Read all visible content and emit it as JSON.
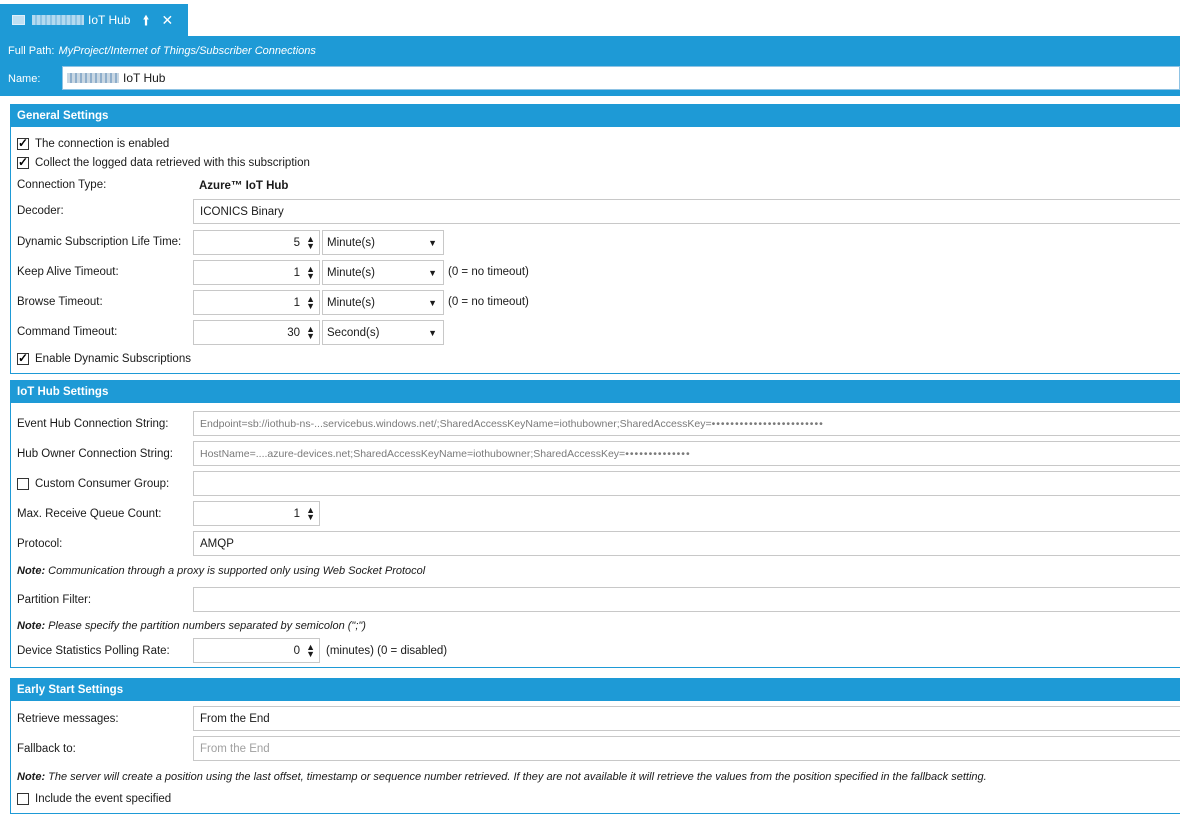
{
  "tab": {
    "title": "IoT Hub",
    "pin_icon": "pin-icon",
    "close_icon": "close-icon"
  },
  "header": {
    "full_path_label": "Full Path:",
    "full_path_value": "MyProject/Internet of Things/Subscriber Connections",
    "name_label": "Name:",
    "name_value": "IoT Hub"
  },
  "general": {
    "title": "General Settings",
    "enabled_label": "The connection is enabled",
    "collect_label": "Collect the logged data retrieved with this subscription",
    "connection_type_label": "Connection Type:",
    "connection_type_value": "Azure™ IoT Hub",
    "decoder_label": "Decoder:",
    "decoder_value": "ICONICS Binary",
    "dyn_life_label": "Dynamic Subscription Life Time:",
    "dyn_life_value": "5",
    "dyn_life_unit": "Minute(s)",
    "keep_alive_label": "Keep Alive Timeout:",
    "keep_alive_value": "1",
    "keep_alive_unit": "Minute(s)",
    "keep_alive_hint": "(0 = no timeout)",
    "browse_label": "Browse Timeout:",
    "browse_value": "1",
    "browse_unit": "Minute(s)",
    "browse_hint": "(0 = no timeout)",
    "command_label": "Command Timeout:",
    "command_value": "30",
    "command_unit": "Second(s)",
    "enable_dyn_label": "Enable Dynamic Subscriptions"
  },
  "iothub": {
    "title": "IoT Hub Settings",
    "event_conn_label": "Event Hub Connection String:",
    "event_conn_value": "Endpoint=sb://iothub-ns-...servicebus.windows.net/;SharedAccessKeyName=iothubowner;SharedAccessKey=",
    "event_conn_mask": "••••••••••••••••••••••••",
    "hub_owner_label": "Hub Owner Connection String:",
    "hub_owner_value": "HostName=....azure-devices.net;SharedAccessKeyName=iothubowner;SharedAccessKey=",
    "hub_owner_mask": "••••••••••••••",
    "custom_group_label": "Custom Consumer Group:",
    "max_queue_label": "Max. Receive Queue Count:",
    "max_queue_value": "1",
    "protocol_label": "Protocol:",
    "protocol_value": "AMQP",
    "note1_prefix": "Note:",
    "note1_text": " Communication through a proxy is supported only using Web Socket Protocol",
    "partition_label": "Partition Filter:",
    "note2_prefix": "Note:",
    "note2_text": " Please specify the partition numbers separated by semicolon (\";\")",
    "stats_label": "Device Statistics Polling Rate:",
    "stats_value": "0",
    "stats_hint": "(minutes) (0 = disabled)"
  },
  "early": {
    "title": "Early Start Settings",
    "retrieve_label": "Retrieve messages:",
    "retrieve_value": "From the End",
    "fallback_label": "Fallback to:",
    "fallback_value": "From the End",
    "note_prefix": "Note:",
    "note_text": " The server will create a position using the last offset, timestamp or sequence number retrieved. If they are not available it will retrieve the values from the position specified in the fallback setting.",
    "include_label": "Include the event specified"
  }
}
